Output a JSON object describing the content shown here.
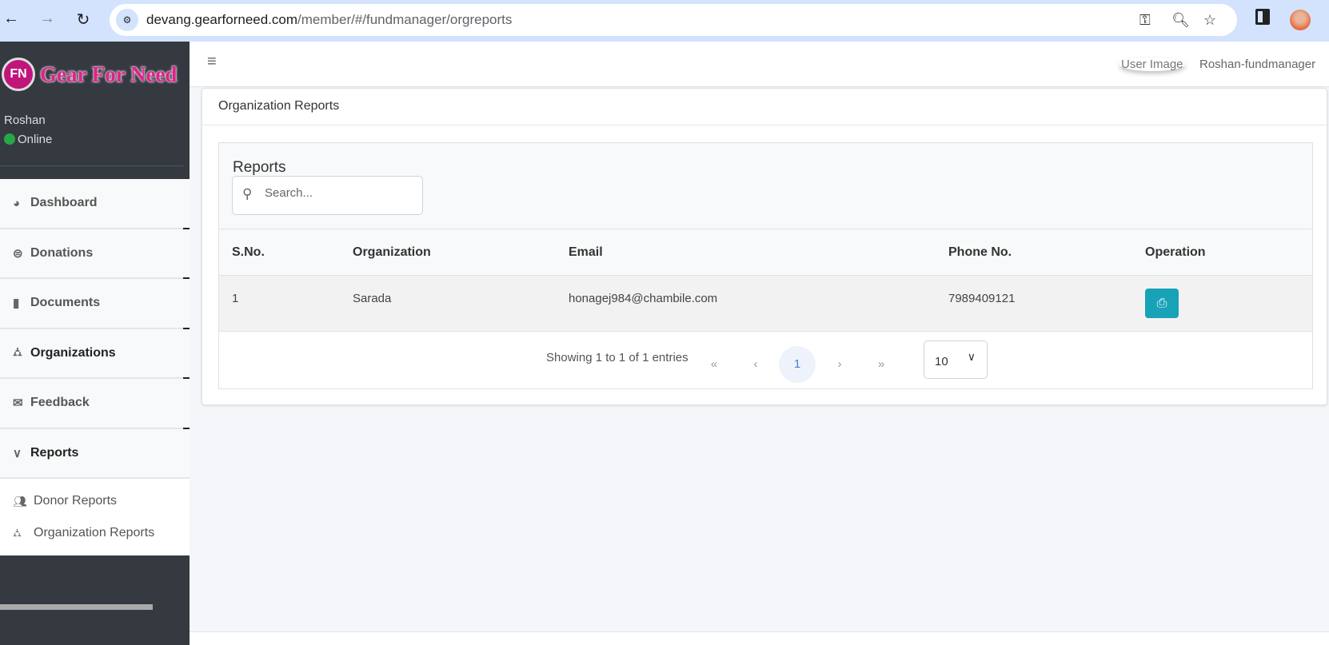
{
  "browser": {
    "url_host": "devang.gearforneed.com",
    "url_path": "/member/#/fundmanager/orgreports",
    "icons": [
      "back-icon",
      "forward-icon",
      "reload-icon",
      "site-settings-icon",
      "key-icon",
      "zoom-icon",
      "star-icon",
      "side-panel-icon",
      "profile-avatar"
    ]
  },
  "sidebar": {
    "logo_text": "Gear For Need",
    "logo_mark": "FN",
    "user": {
      "name": "Roshan",
      "status": "Online",
      "status_color": "#28a745"
    },
    "items": [
      {
        "label": "Dashboard",
        "icon": "chart-pie-icon"
      },
      {
        "label": "Donations",
        "icon": "donate-icon"
      },
      {
        "label": "Documents",
        "icon": "file-icon"
      },
      {
        "label": "Organizations",
        "icon": "sitemap-icon"
      },
      {
        "label": "Feedback",
        "icon": "envelope-icon"
      },
      {
        "label": "Reports",
        "icon": "chevron-down-icon",
        "expanded": true
      }
    ],
    "subitems": [
      {
        "label": "Donor Reports",
        "icon": "users-icon"
      },
      {
        "label": "Organization Reports",
        "icon": "sitemap-icon"
      }
    ]
  },
  "header": {
    "user_image_alt": "User Image",
    "user_role": "Roshan-fundmanager"
  },
  "main": {
    "card_title": "Organization Reports",
    "section_title": "Reports",
    "search": {
      "placeholder": "Search...",
      "value": ""
    },
    "table": {
      "columns": [
        "S.No.",
        "Organization",
        "Email",
        "Phone No.",
        "Operation"
      ],
      "rows": [
        {
          "sno": "1",
          "organization": "Sarada",
          "email": "honagej984@chambile.com",
          "phone": "7989409121",
          "operation": "print"
        }
      ]
    },
    "pagination": {
      "info": "Showing 1 to 1 of 1 entries",
      "first": "«",
      "prev": "‹",
      "current": "1",
      "next": "›",
      "last": "»",
      "page_size": "10"
    },
    "accent": "#17a2b8"
  }
}
